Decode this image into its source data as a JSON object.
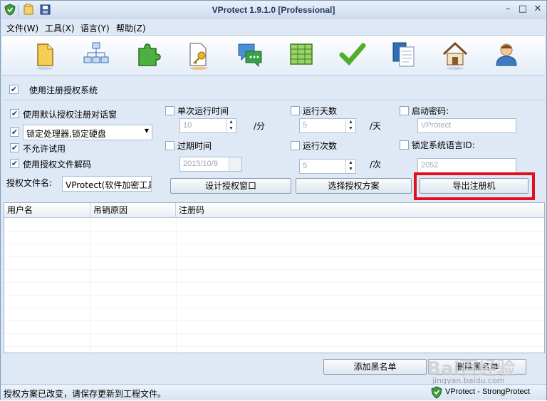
{
  "window": {
    "title": "VProtect 1.9.1.0 [Professional]"
  },
  "menu": [
    "文件(W)",
    "工具(X)",
    "语言(Y)",
    "帮助(Z)"
  ],
  "toolbar": {
    "icons": [
      "file-icon",
      "network-icon",
      "puzzle-icon",
      "key-document-icon",
      "chat-icon",
      "spreadsheet-icon",
      "checkmark-icon",
      "copy-documents-icon",
      "house-lock-icon",
      "user-icon"
    ]
  },
  "main": {
    "use_reg_system": "使用注册授权系统",
    "use_reg_system_checked": true
  },
  "options": {
    "use_default_dialog": "使用默认授权注册对话窗",
    "lock_select": "锁定处理器,锁定硬盘",
    "disallow_trial": "不允许试用",
    "use_auth_file_decode": "使用授权文件解码",
    "auth_file_label": "授权文件名:",
    "auth_file_value": "VProtect(软件加密工具"
  },
  "timers": {
    "single_run_label": "单次运行时间",
    "single_run_value": "10",
    "single_run_unit": "/分",
    "expire_label": "过期时间",
    "expire_value": "2015/10/8",
    "run_days_label": "运行天数",
    "run_days_value": "5",
    "run_days_unit": "/天",
    "run_count_label": "运行次数",
    "run_count_value": "5",
    "run_count_unit": "/次",
    "startup_pwd_label": "启动密码:",
    "startup_pwd_value": "VProtect",
    "lock_lang_label": "锁定系统语言ID:",
    "lock_lang_value": "2052"
  },
  "buttons": {
    "design": "设计授权窗口",
    "choose": "选择授权方案",
    "export": "导出注册机",
    "add_black": "添加黑名单",
    "del_black": "删除黑名单"
  },
  "table": {
    "columns": [
      "用户名",
      "吊销原因",
      "注册码"
    ]
  },
  "status": {
    "text": "授权方案已改变，请保存更新到工程文件。",
    "brand": "VProtect - StrongProtect"
  },
  "watermark": {
    "logo": "Bai百经验",
    "url": "jingyan.baidu.com"
  },
  "colors": {
    "highlight": "#e1101c",
    "window_bg": "#dfe8f5"
  }
}
